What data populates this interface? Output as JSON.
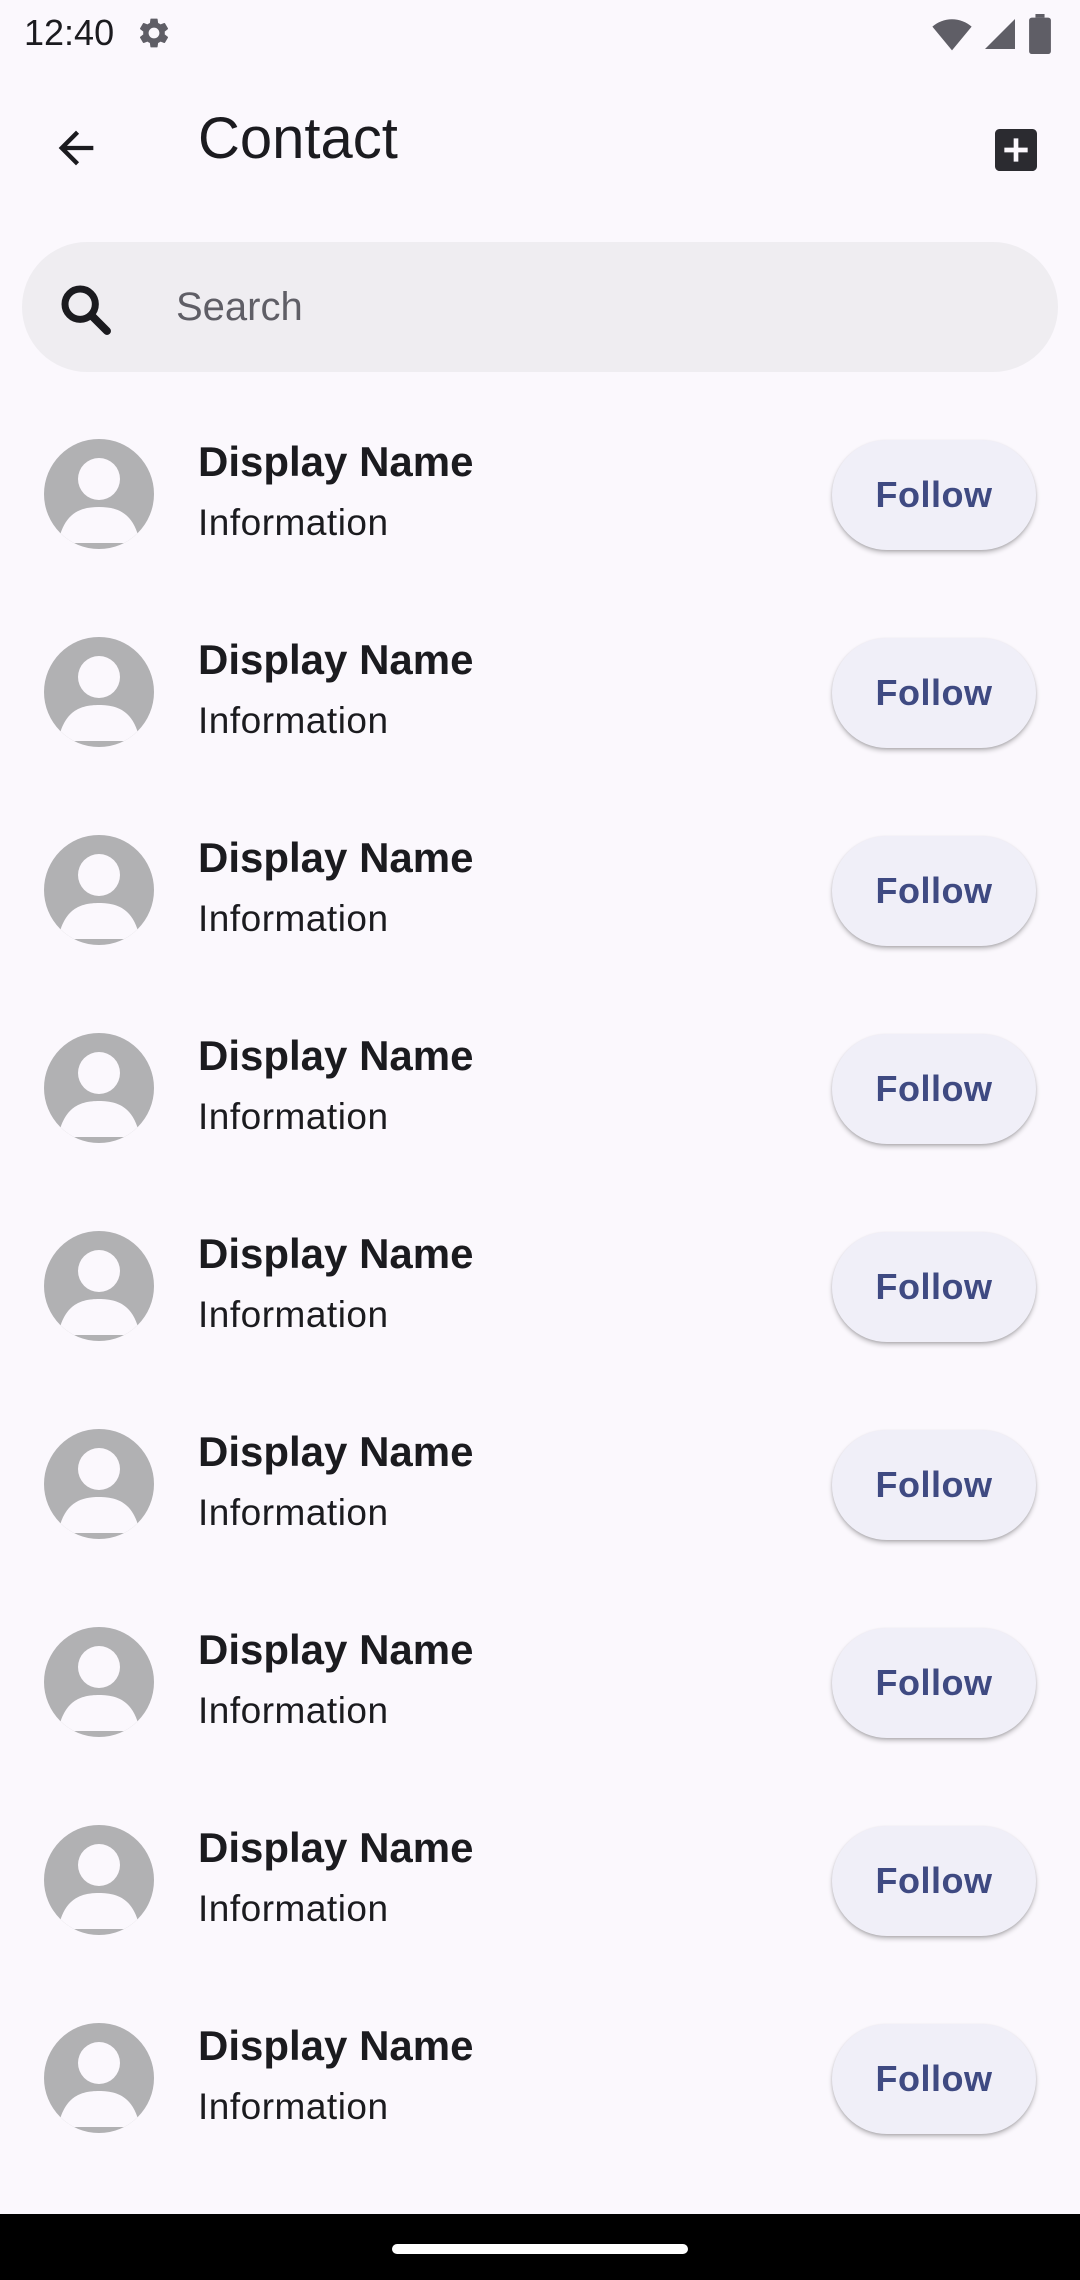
{
  "status_bar": {
    "time": "12:40",
    "icons": [
      "gear-icon",
      "wifi-icon",
      "signal-icon",
      "battery-icon"
    ]
  },
  "app_bar": {
    "title": "Contact",
    "back_icon": "arrow-back-icon",
    "add_icon": "add-box-icon"
  },
  "search": {
    "placeholder": "Search",
    "value": ""
  },
  "contacts": [
    {
      "name": "Display Name",
      "info": "Information",
      "action": "Follow"
    },
    {
      "name": "Display Name",
      "info": "Information",
      "action": "Follow"
    },
    {
      "name": "Display Name",
      "info": "Information",
      "action": "Follow"
    },
    {
      "name": "Display Name",
      "info": "Information",
      "action": "Follow"
    },
    {
      "name": "Display Name",
      "info": "Information",
      "action": "Follow"
    },
    {
      "name": "Display Name",
      "info": "Information",
      "action": "Follow"
    },
    {
      "name": "Display Name",
      "info": "Information",
      "action": "Follow"
    },
    {
      "name": "Display Name",
      "info": "Information",
      "action": "Follow"
    },
    {
      "name": "Display Name",
      "info": "Information",
      "action": "Follow"
    }
  ],
  "colors": {
    "background": "#fbf8fd",
    "search_bg": "#efedf1",
    "button_bg": "#f0eff8",
    "button_text": "#3f4a82",
    "avatar_bg": "#b1b1b3"
  }
}
